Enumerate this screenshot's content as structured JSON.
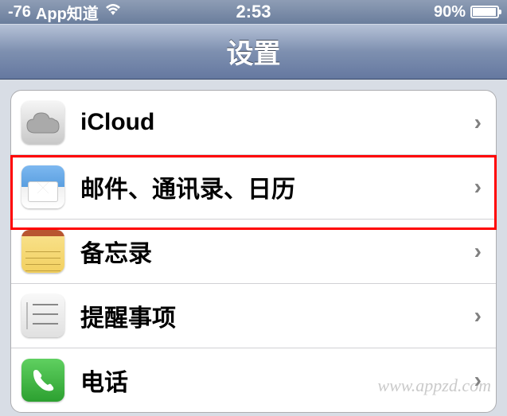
{
  "status_bar": {
    "signal": "-76",
    "carrier": "App知道",
    "time": "2:53",
    "battery_pct": "90%"
  },
  "nav": {
    "title": "设置"
  },
  "settings_items": [
    {
      "id": "icloud",
      "label": "iCloud",
      "icon": "cloud-icon"
    },
    {
      "id": "mail",
      "label": "邮件、通讯录、日历",
      "icon": "mail-icon",
      "highlighted": true
    },
    {
      "id": "notes",
      "label": "备忘录",
      "icon": "notes-icon"
    },
    {
      "id": "reminders",
      "label": "提醒事项",
      "icon": "reminders-icon"
    },
    {
      "id": "phone",
      "label": "电话",
      "icon": "phone-icon"
    }
  ],
  "watermark": "www.appzd.com"
}
